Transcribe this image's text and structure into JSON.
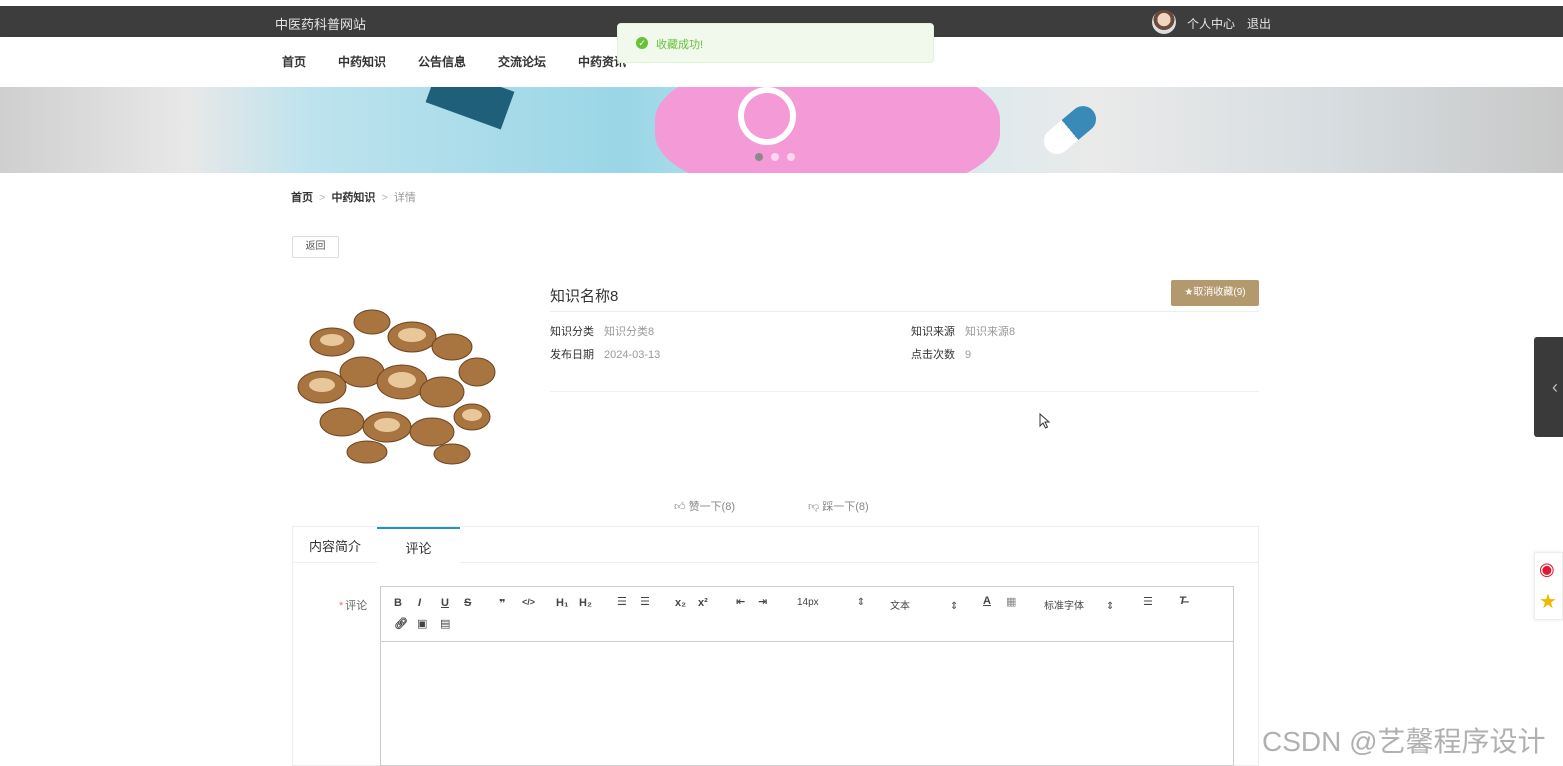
{
  "header": {
    "site_title": "中医药科普网站",
    "user_center": "个人中心",
    "logout": "退出"
  },
  "nav": {
    "items": [
      "首页",
      "中药知识",
      "公告信息",
      "交流论坛",
      "中药资讯"
    ]
  },
  "toast": {
    "message": "收藏成功!"
  },
  "banner": {
    "slide_count": 3,
    "active_slide": 1
  },
  "breadcrumb": {
    "home": "首页",
    "section": "中药知识",
    "current": "详情",
    "separator": ">"
  },
  "back_button": "返回",
  "item": {
    "title": "知识名称8",
    "favorite_button": "★取消收藏(9)",
    "category_label": "知识分类",
    "category_value": "知识分类8",
    "source_label": "知识来源",
    "source_value": "知识来源8",
    "date_label": "发布日期",
    "date_value": "2024-03-13",
    "clicks_label": "点击次数",
    "clicks_value": "9"
  },
  "votes": {
    "like": "赞一下(8)",
    "dislike": "踩一下(8)"
  },
  "tabs": {
    "items": [
      "内容简介",
      "评论"
    ],
    "active": "评论"
  },
  "comment_form": {
    "label": "评论",
    "required_mark": "*",
    "font_size": "14px",
    "text_style": "文本",
    "font_family": "标准字体"
  },
  "colors": {
    "topbar": "#3d3d3d",
    "favorite": "#b39a6e",
    "tab_active": "#1f91cf",
    "toast_green": "#67c23a"
  },
  "watermark": "CSDN @艺馨程序设计"
}
